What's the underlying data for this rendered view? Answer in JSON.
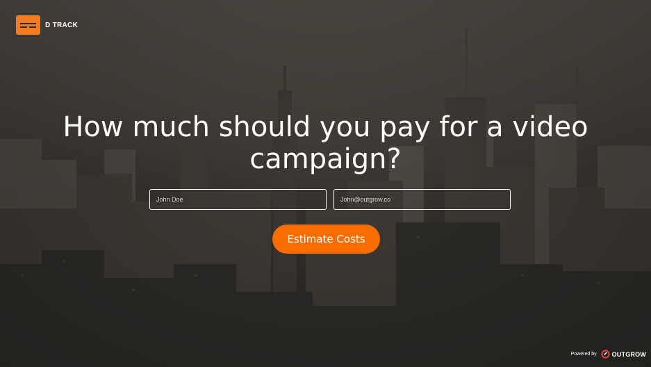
{
  "brand": {
    "logo_text": "D TRACK",
    "accent": "#f47b20"
  },
  "hero": {
    "headline": "How much should you pay for a video campaign?"
  },
  "form": {
    "name_placeholder": "John Doe",
    "email_placeholder": "John@outgrow.co",
    "cta_label": "Estimate Costs",
    "cta_color": "#f96d00"
  },
  "footer": {
    "powered_label": "Powered by",
    "brand": "OUTGROW",
    "brand_icon": "outgrow-icon"
  }
}
